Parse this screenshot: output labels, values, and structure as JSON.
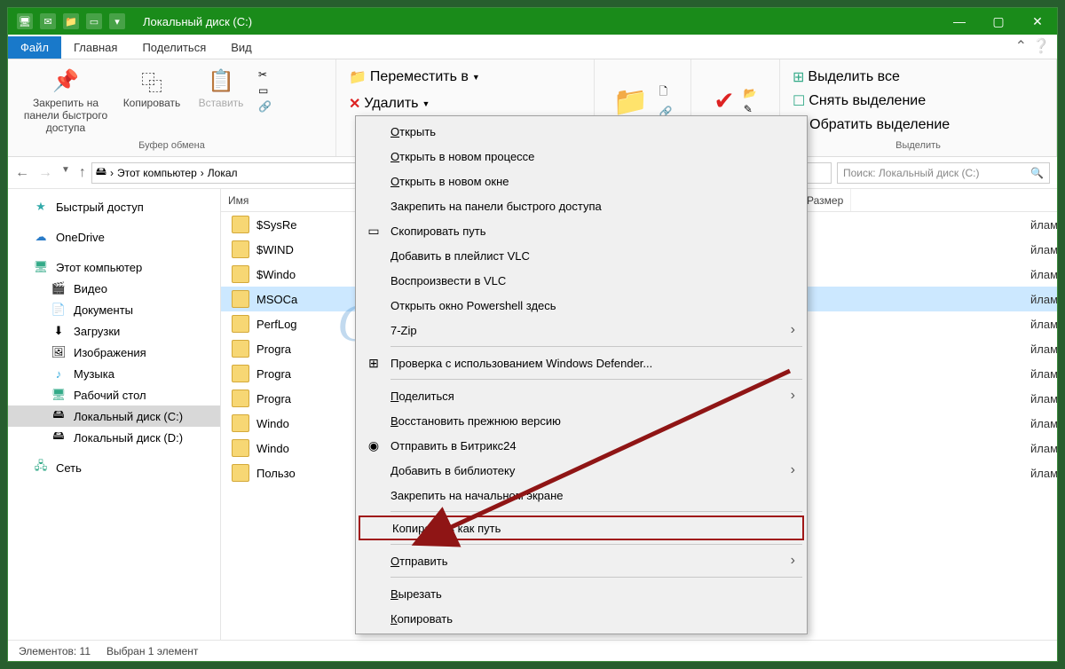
{
  "titlebar": {
    "title": "Локальный диск (C:)"
  },
  "tabs": {
    "file": "Файл",
    "home": "Главная",
    "share": "Поделиться",
    "view": "Вид"
  },
  "ribbon": {
    "pin": "Закрепить на панели быстрого доступа",
    "copy": "Копировать",
    "paste": "Вставить",
    "clipboard_label": "Буфер обмена",
    "move_to": "Переместить в",
    "delete": "Удалить",
    "select_all": "Выделить все",
    "select_none": "Снять выделение",
    "invert_sel": "Обратить выделение",
    "select_label": "Выделить"
  },
  "breadcrumb": {
    "pc": "Этот компьютер",
    "drive": "Локал"
  },
  "search": {
    "placeholder": "Поиск: Локальный диск (C:)"
  },
  "nav": {
    "quick": "Быстрый доступ",
    "onedrive": "OneDrive",
    "thispc": "Этот компьютер",
    "video": "Видео",
    "documents": "Документы",
    "downloads": "Загрузки",
    "pictures": "Изображения",
    "music": "Музыка",
    "desktop": "Рабочий стол",
    "drive_c": "Локальный диск (C:)",
    "drive_d": "Локальный диск (D:)",
    "network": "Сеть"
  },
  "columns": {
    "name": "Имя",
    "size": "Размер"
  },
  "files": [
    {
      "name": "$SysRe",
      "type": "йлами"
    },
    {
      "name": "$WIND",
      "type": "йлами"
    },
    {
      "name": "$Windo",
      "type": "йлами"
    },
    {
      "name": "MSOCa",
      "type": "йлами"
    },
    {
      "name": "PerfLog",
      "type": "йлами"
    },
    {
      "name": "Progra",
      "type": "йлами"
    },
    {
      "name": "Progra",
      "type": "йлами"
    },
    {
      "name": "Progra",
      "type": "йлами"
    },
    {
      "name": "Windo",
      "type": "йлами"
    },
    {
      "name": "Windo",
      "type": "йлами"
    },
    {
      "name": "Пользо",
      "type": "йлами"
    }
  ],
  "status": {
    "count": "Элементов: 11",
    "selected": "Выбран 1 элемент"
  },
  "context_menu": [
    {
      "label": "Открыть",
      "u": true
    },
    {
      "label": "Открыть в новом процессе",
      "u": true
    },
    {
      "label": "Открыть в новом окне",
      "u": true
    },
    {
      "label": "Закрепить на панели быстрого доступа"
    },
    {
      "label": "Скопировать путь",
      "icon": "▭"
    },
    {
      "label": "Добавить в плейлист VLC"
    },
    {
      "label": "Воспроизвести в VLC"
    },
    {
      "label": "Открыть окно Powershell здесь"
    },
    {
      "label": "7-Zip",
      "arrow": true
    },
    {
      "sep": true
    },
    {
      "label": "Проверка с использованием Windows Defender...",
      "icon": "⊞"
    },
    {
      "sep": true
    },
    {
      "label": "Поделиться",
      "u": true,
      "arrow": true
    },
    {
      "label": "Восстановить прежнюю версию",
      "u": true
    },
    {
      "label": "Отправить в Битрикс24",
      "icon": "◉"
    },
    {
      "label": "Добавить в библиотеку",
      "u": true,
      "arrow": true
    },
    {
      "label": "Закрепить на начальном экране"
    },
    {
      "sep": true
    },
    {
      "label": "Копировать как путь",
      "hl": true
    },
    {
      "sep": true
    },
    {
      "label": "Отправить",
      "u": true,
      "arrow": true
    },
    {
      "sep": true
    },
    {
      "label": "Вырезать",
      "u": true
    },
    {
      "label": "Копировать",
      "u": true
    }
  ],
  "watermark": "G-ek.com"
}
